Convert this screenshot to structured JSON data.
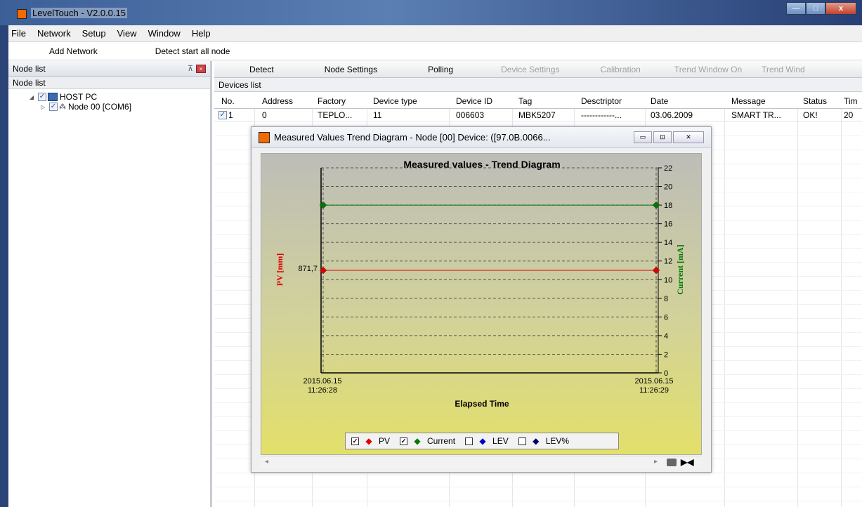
{
  "window": {
    "title": "LevelTouch - V2.0.0.15",
    "btn_min": "—",
    "btn_max": "□",
    "btn_close": "x"
  },
  "menu": [
    "File",
    "Network",
    "Setup",
    "View",
    "Window",
    "Help"
  ],
  "toolbar": {
    "add_network": "Add Network",
    "detect_all": "Detect start all node"
  },
  "left_panel": {
    "header": "Node list",
    "subheader": "Node list",
    "host": "HOST PC",
    "node": "Node 00 [COM6]"
  },
  "tabs": [
    "Detect",
    "Node Settings",
    "Polling",
    "Device Settings",
    "Calibration",
    "Trend Window On",
    "Trend Wind"
  ],
  "devices": {
    "title": "Devices list",
    "columns": [
      "No.",
      "Address",
      "Factory",
      "Device type",
      "Device ID",
      "Tag",
      "Desctriptor",
      "Date",
      "Message",
      "Status",
      "Tim"
    ],
    "rows": [
      [
        "1",
        "0",
        "TEPLO...",
        "11",
        "006603",
        "MBK5207",
        "------------...",
        "03.06.2009",
        "SMART TR...",
        "OK!",
        "20"
      ]
    ]
  },
  "trend_window": {
    "title": "Measured Values Trend Diagram - Node [00] Device: ([97.0B.0066...",
    "scroll_left": "◂",
    "scroll_right": "▸"
  },
  "chart_data": {
    "type": "line",
    "title": "Measured values - Trend Diagram",
    "xlabel": "Elapsed Time",
    "ylabel_left": "PV [mm]",
    "ylabel_right": "Current [mA]",
    "x": [
      "2015.06.15 11:26:28",
      "2015.06.15 11:26:29"
    ],
    "right_axis": {
      "ylim": [
        0,
        22
      ],
      "ticks": [
        "0",
        "2",
        "4",
        "6",
        "8",
        "10",
        "12",
        "14",
        "16",
        "18",
        "20",
        "22"
      ]
    },
    "left_axis": {
      "tick_label": "871,7"
    },
    "series": [
      {
        "name": "PV",
        "color": "#e00000",
        "checked": true,
        "values": [
          871.7,
          871.7
        ],
        "right_axis_equiv": 11
      },
      {
        "name": "Current",
        "color": "#007a00",
        "checked": true,
        "values": [
          18,
          18
        ]
      },
      {
        "name": "LEV",
        "color": "#0000cc",
        "checked": false,
        "values": []
      },
      {
        "name": "LEV%",
        "color": "#000066",
        "checked": false,
        "values": []
      }
    ],
    "grid": true,
    "legend": "bottom"
  }
}
